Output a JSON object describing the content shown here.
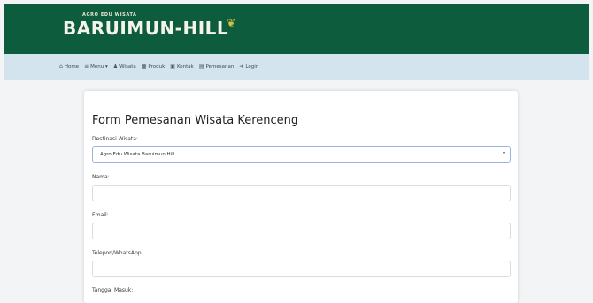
{
  "brand": {
    "tagline": "AGRO EDU WISATA",
    "name": "BARUIMUN-HILL",
    "colors": {
      "header": "#0d5c3e",
      "nav": "#d3e4ef"
    }
  },
  "nav": {
    "items": [
      {
        "icon": "home-icon",
        "glyph": "⌂",
        "label": "Home"
      },
      {
        "icon": "menu-icon",
        "glyph": "≡",
        "label": "Menu ▾"
      },
      {
        "icon": "person-icon",
        "glyph": "♟",
        "label": "Wisata"
      },
      {
        "icon": "shop-icon",
        "glyph": "▦",
        "label": "Produk"
      },
      {
        "icon": "contact-icon",
        "glyph": "▣",
        "label": "Kontak"
      },
      {
        "icon": "order-icon",
        "glyph": "▤",
        "label": "Pemesanan"
      },
      {
        "icon": "login-icon",
        "glyph": "➜",
        "label": "Login"
      }
    ]
  },
  "form": {
    "title": "Form Pemesanan Wisata Kerenceng",
    "destination_label": "Destinasi Wisata:",
    "destination_value": "Agro Edu Wisata Baruimun Hill",
    "name_label": "Nama:",
    "email_label": "Email:",
    "phone_label": "Telepon/WhatsApp:",
    "date_label": "Tanggal Masuk:"
  }
}
